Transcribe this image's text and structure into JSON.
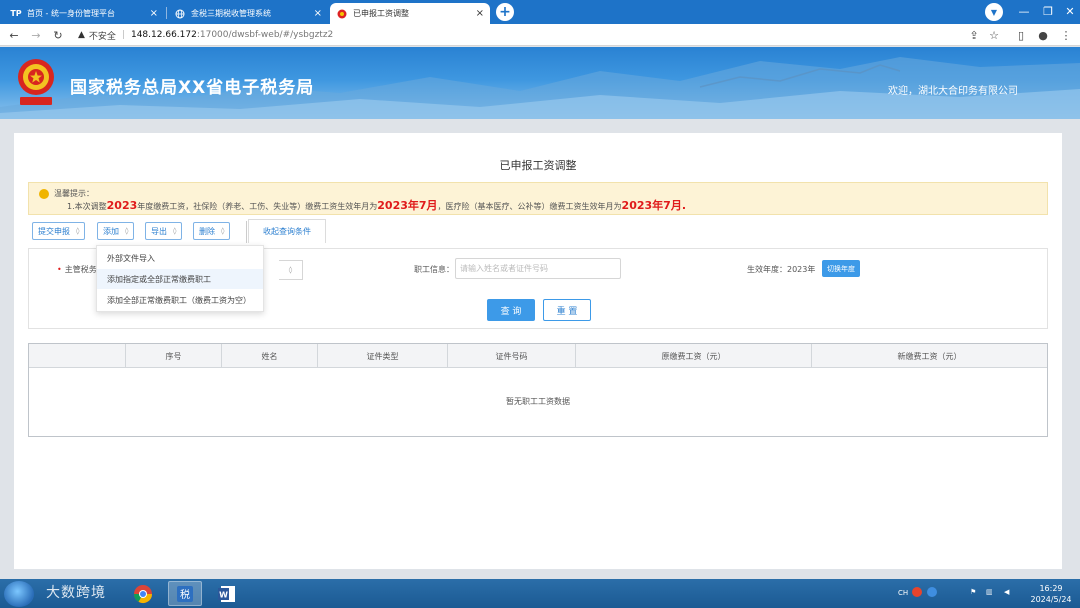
{
  "browser": {
    "tabs": [
      {
        "label": "首页 - 统一身份管理平台",
        "icon": "tp-logo-icon"
      },
      {
        "label": "金税三期税收管理系统",
        "icon": "globe-icon"
      },
      {
        "label": "已申报工资调整",
        "icon": "tax-emblem-icon"
      }
    ],
    "address": {
      "security_label": "不安全",
      "host": "148.12.66.172",
      "path": ":17000/dwsbf-web/#/ysbgztz2"
    }
  },
  "site": {
    "title": "国家税务总局XX省电子税务局",
    "welcome": "欢迎，湖北大合印务有限公司"
  },
  "page": {
    "title": "已申报工资调整",
    "notice": {
      "heading": "温馨提示：",
      "line_prefix": "1.本次调整",
      "year": "2023",
      "line_mid1": "年度缴费工资，社保险（养老、工伤、失业等）缴费工资生效年月为",
      "date1": "2023年7月",
      "line_mid2": "，医疗险（基本医疗、公补等）缴费工资生效年月为",
      "date2": "2023年7月."
    },
    "toolbar": {
      "submit": "提交申报",
      "add": "添加",
      "export": "导出",
      "delete": "删除",
      "query_tab": "收起查询条件"
    },
    "dropdown": {
      "items": [
        "外部文件导入",
        "添加指定或全部正常缴费职工",
        "添加全部正常缴费职工（缴费工资为空）"
      ]
    },
    "query": {
      "tax_authority_label": "主管税务",
      "employee_label": "职工信息：",
      "employee_placeholder": "请输入姓名或者证件号码",
      "effective_year_label": "生效年度：",
      "effective_year_value": "2023年",
      "switch_year": "切换年度",
      "search_button": "查 询",
      "reset_button": "重 置"
    },
    "table": {
      "columns": [
        "",
        "序号",
        "姓名",
        "证件类型",
        "证件号码",
        "原缴费工资（元）",
        "新缴费工资（元）"
      ],
      "empty_text": "暂无职工工资数据"
    }
  },
  "taskbar": {
    "watermark": "大数跨境",
    "tray_lang": "CH",
    "clock_time": "16:29",
    "clock_date": "2024/5/24"
  },
  "colors": {
    "browser_blue": "#1e73c8",
    "accent_blue": "#3d9ae8",
    "notice_red": "#e01b1b",
    "notice_bg": "#fdf3d6"
  }
}
